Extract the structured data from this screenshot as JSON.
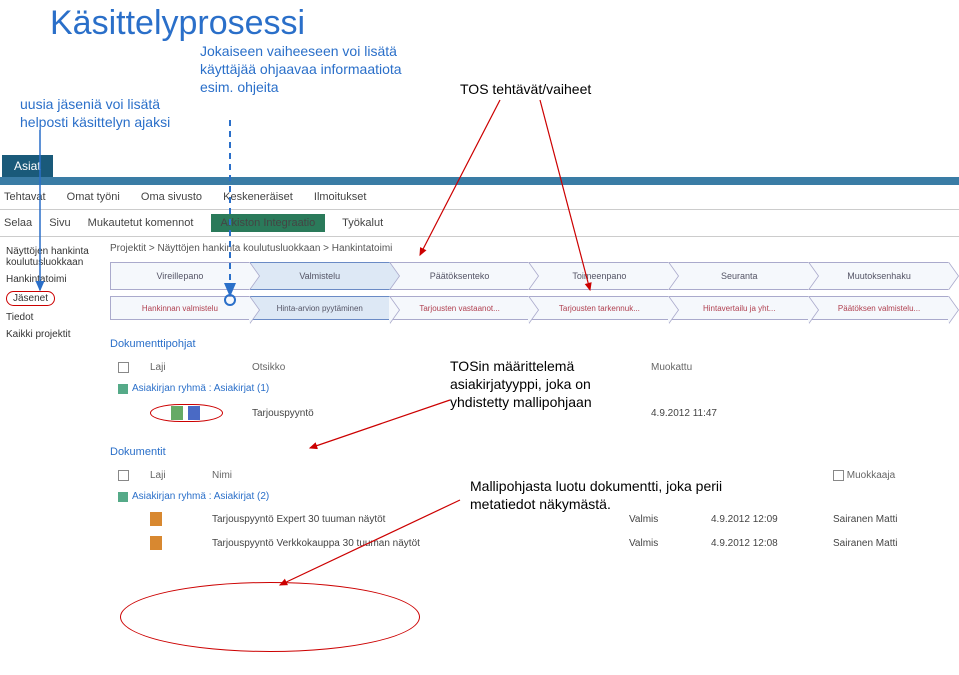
{
  "slide": {
    "title": "Käsittelyprosessi"
  },
  "annotations": {
    "left": "uusia jäseniä voi lisätä helposti käsittelyn ajaksi",
    "mid": "Jokaiseen vaiheeseen voi lisätä käyttäjää ohjaavaa informaatiota esim. ohjeita",
    "right": "TOS tehtävät/vaiheet",
    "tosin": "TOSin määrittelemä asiakirjatyyppi, joka on yhdistetty mallipohjaan",
    "malli": "Mallipohjasta luotu dokumentti, joka perii metatiedot näkymästä."
  },
  "tabs": {
    "asiat": "Asiat"
  },
  "nav1": [
    "Tehtavat",
    "Omat työni",
    "Oma sivusto",
    "Keskeneräiset",
    "Ilmoitukset"
  ],
  "nav2": {
    "items": [
      "Selaa",
      "Sivu",
      "Mukautetut komennot"
    ],
    "active": "Arkiston Integraatio",
    "last": "Työkalut"
  },
  "sidebar": {
    "items": [
      "Näyttöjen hankinta koulutusluokkaan",
      "Hankintatoimi",
      "Jäsenet",
      "Tiedot",
      "Kaikki projektit"
    ]
  },
  "breadcrumb": "Projektit > Näyttöjen hankinta koulutusluokkaan > Hankintatoimi",
  "phases1": [
    "Vireillepano",
    "Valmistelu",
    "Päätöksenteko",
    "Toimeenpano",
    "Seuranta",
    "Muutoksenhaku"
  ],
  "phases2": [
    "Hankinnan valmistelu",
    "Hinta-arvion pyytäminen",
    "Tarjousten vastaanot...",
    "Tarjousten tarkennuk...",
    "Hintavertailu ja yht...",
    "Päätöksen valmistelu..."
  ],
  "section1": {
    "title": "Dokumenttipohjat",
    "cols": [
      "Laji",
      "Otsikko",
      "Muokattu"
    ],
    "group": "Asiakirjan ryhmä : Asiakirjat (1)",
    "row": {
      "otsikko": "Tarjouspyyntö",
      "muokattu": "4.9.2012 11:47"
    }
  },
  "section2": {
    "title": "Dokumentit",
    "cols": [
      "Laji",
      "Nimi",
      "",
      "",
      "Muokkaaja"
    ],
    "group": "Asiakirjan ryhmä : Asiakirjat (2)",
    "rows": [
      {
        "nimi": "Tarjouspyyntö Expert 30 tuuman näytöt",
        "tila": "Valmis",
        "muokattu": "4.9.2012 12:09",
        "muokkaaja": "Sairanen Matti"
      },
      {
        "nimi": "Tarjouspyyntö Verkkokauppa 30 tuuman näytöt",
        "tila": "Valmis",
        "muokattu": "4.9.2012 12:08",
        "muokkaaja": "Sairanen Matti"
      }
    ]
  }
}
